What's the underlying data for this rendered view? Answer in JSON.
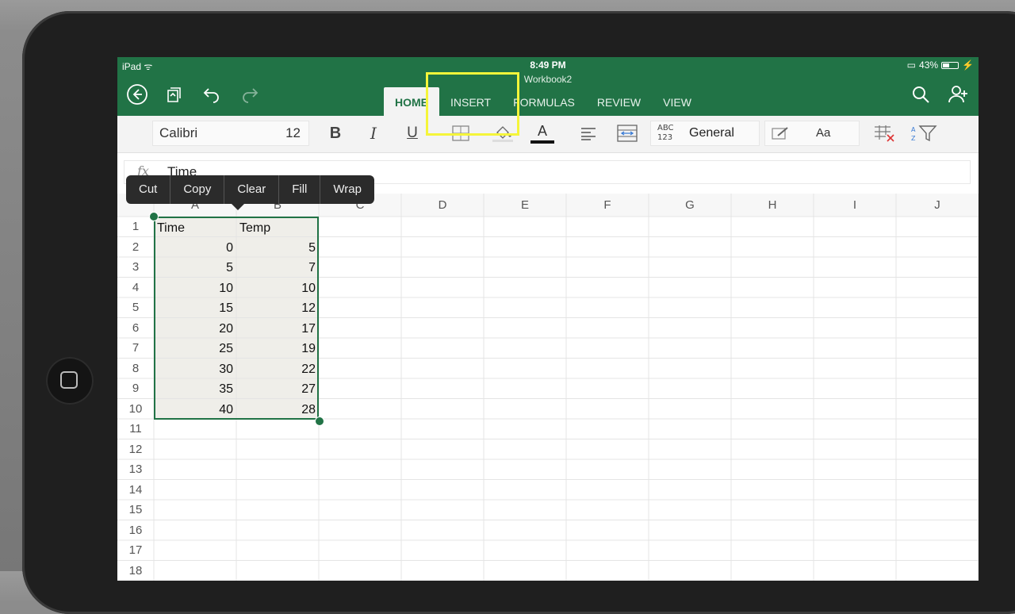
{
  "status": {
    "device": "iPad",
    "time": "8:49 PM",
    "battery": "43%"
  },
  "workbook": {
    "title": "Workbook2"
  },
  "tabs": [
    "HOME",
    "INSERT",
    "FORMULAS",
    "REVIEW",
    "VIEW"
  ],
  "toolbar": {
    "font_name": "Calibri",
    "font_size": "12",
    "bold": "B",
    "italic": "I",
    "underline": "U",
    "font_color": "A",
    "number_format_abbr": "ABC 123",
    "number_format": "General",
    "styles": "Aa"
  },
  "formula_bar": {
    "fx": "fx",
    "value": "Time"
  },
  "context_menu": [
    "Cut",
    "Copy",
    "Clear",
    "Fill",
    "Wrap"
  ],
  "columns": [
    "A",
    "B",
    "C",
    "D",
    "E",
    "F",
    "G",
    "H",
    "I",
    "J"
  ],
  "rows": [
    "1",
    "2",
    "3",
    "4",
    "5",
    "6",
    "7",
    "8",
    "9",
    "10",
    "11",
    "12",
    "13",
    "14",
    "15",
    "16",
    "17",
    "18"
  ],
  "sheet": {
    "headers": [
      "Time",
      "Temp"
    ],
    "data": [
      [
        "0",
        "5"
      ],
      [
        "5",
        "7"
      ],
      [
        "10",
        "10"
      ],
      [
        "15",
        "12"
      ],
      [
        "20",
        "17"
      ],
      [
        "25",
        "19"
      ],
      [
        "30",
        "22"
      ],
      [
        "35",
        "27"
      ],
      [
        "40",
        "28"
      ]
    ]
  },
  "colors": {
    "accent": "#217346",
    "highlight": "#f5f53a"
  }
}
